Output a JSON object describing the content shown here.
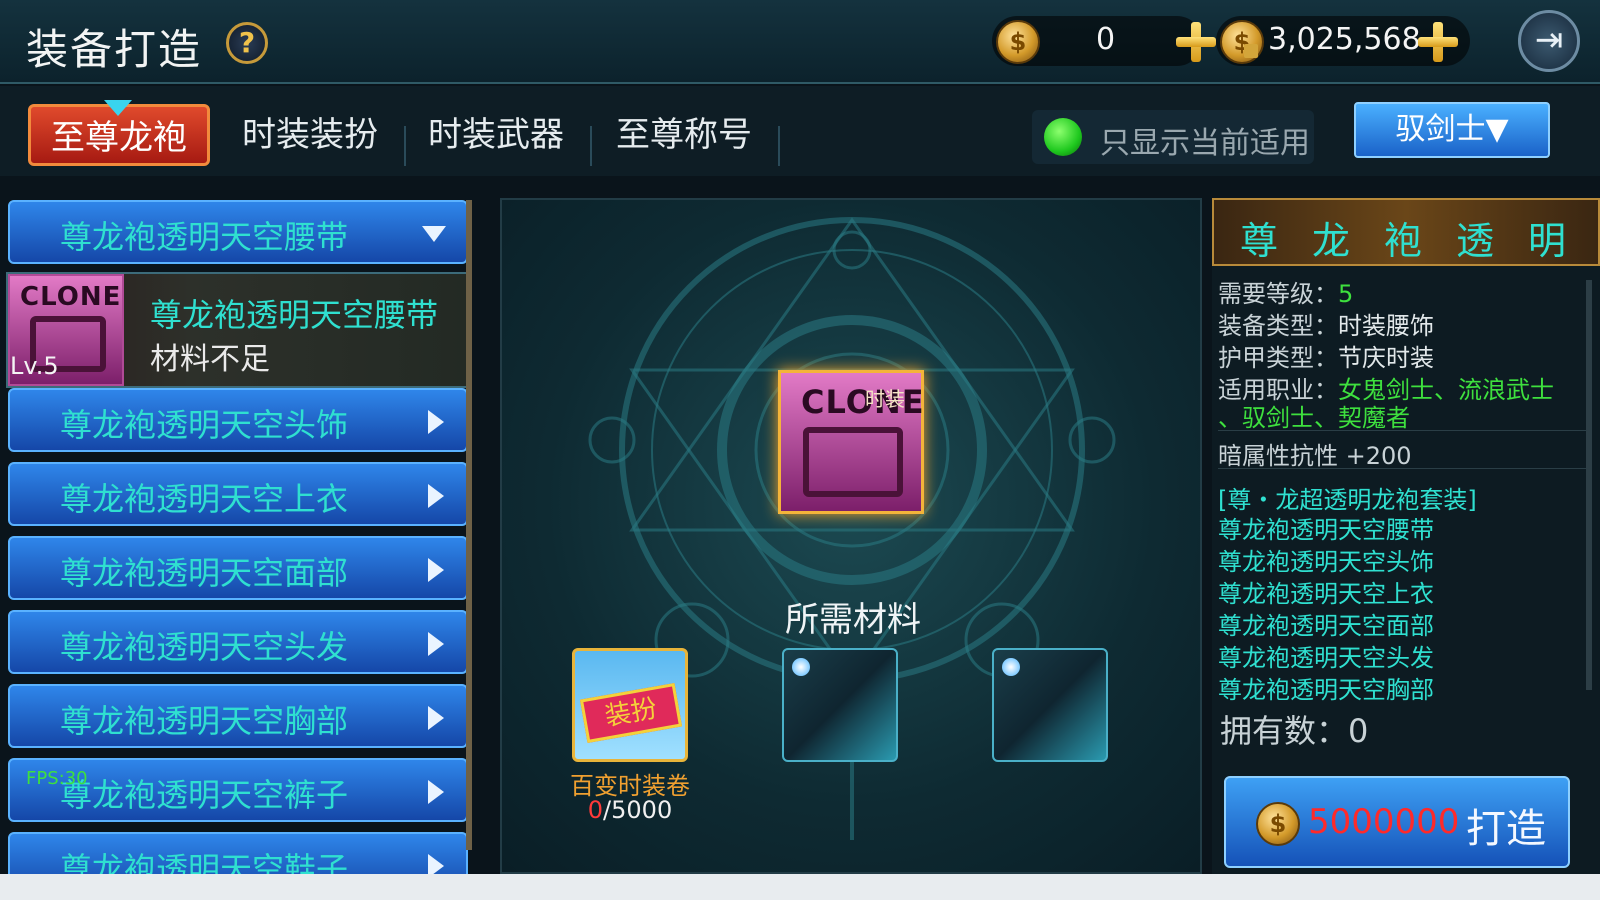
{
  "header": {
    "title": "装备打造",
    "help_icon": "question-icon",
    "currency": [
      {
        "icon": "coin-icon",
        "value": "0"
      },
      {
        "icon": "locked-coin-icon",
        "value": "3,025,568"
      }
    ],
    "exit_icon": "exit-icon"
  },
  "tabs": [
    {
      "label": "至尊龙袍",
      "active": true
    },
    {
      "label": "时装装扮",
      "active": false
    },
    {
      "label": "时装武器",
      "active": false
    },
    {
      "label": "至尊称号",
      "active": false
    }
  ],
  "filter": {
    "label": "只显示当前适用",
    "on": true
  },
  "class_select": {
    "label": "驭剑士▼"
  },
  "left_list": {
    "expanded_category": "尊龙袍透明天空腰带",
    "selected_item": {
      "name": "尊龙袍透明天空腰带",
      "status": "材料不足",
      "level": "Lv.5",
      "icon_text": "CLONE"
    },
    "categories": [
      "尊龙袍透明天空头饰",
      "尊龙袍透明天空上衣",
      "尊龙袍透明天空面部",
      "尊龙袍透明天空头发",
      "尊龙袍透明天空胸部",
      "尊龙袍透明天空裤子",
      "尊龙袍透明天空鞋子"
    ],
    "fps_label": "FPS:30"
  },
  "center": {
    "item_tag": "时装",
    "item_icon_text": "CLONE",
    "materials_title": "所需材料",
    "materials": [
      {
        "name": "百变时装卷",
        "have": "0",
        "need": "/5000",
        "badge": "装扮"
      },
      {
        "empty": true
      },
      {
        "empty": true
      }
    ]
  },
  "detail": {
    "title": "尊龙袍透明天",
    "level_label": "需要等级：",
    "level_value": "5",
    "type_label": "装备类型：",
    "type_value": "时装腰饰",
    "armor_label": "护甲类型：",
    "armor_value": "节庆时装",
    "class_label": "适用职业：",
    "class_value_1": "女鬼剑士、流浪武士",
    "class_value_2": "、驭剑士、契魔者",
    "resist": "暗属性抗性 +200",
    "set_title": "[尊・龙超透明龙袍套装]",
    "set_items": [
      "尊龙袍透明天空腰带",
      "尊龙袍透明天空头饰",
      "尊龙袍透明天空上衣",
      "尊龙袍透明天空面部",
      "尊龙袍透明天空头发",
      "尊龙袍透明天空胸部"
    ],
    "owned": "拥有数：0"
  },
  "craft": {
    "cost": "5000000",
    "label": "打造"
  },
  "colors": {
    "accent": "#2fe0d0",
    "tab_active": "#d2361e",
    "button_blue": "#1a62c8",
    "warn": "#ff2a2a"
  }
}
